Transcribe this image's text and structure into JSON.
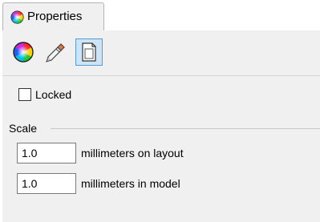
{
  "tab": {
    "title": "Properties",
    "icon": "color-wheel-icon"
  },
  "toolbar": {
    "buttons": [
      {
        "name": "color-wheel-icon",
        "active": false
      },
      {
        "name": "paint-tube-icon",
        "active": false
      },
      {
        "name": "page-icon",
        "active": true
      }
    ]
  },
  "locked": {
    "label": "Locked",
    "checked": false
  },
  "scale": {
    "group_label": "Scale",
    "layout_value": "1.0",
    "layout_label": "millimeters on layout",
    "model_value": "1.0",
    "model_label": "millimeters in model"
  }
}
